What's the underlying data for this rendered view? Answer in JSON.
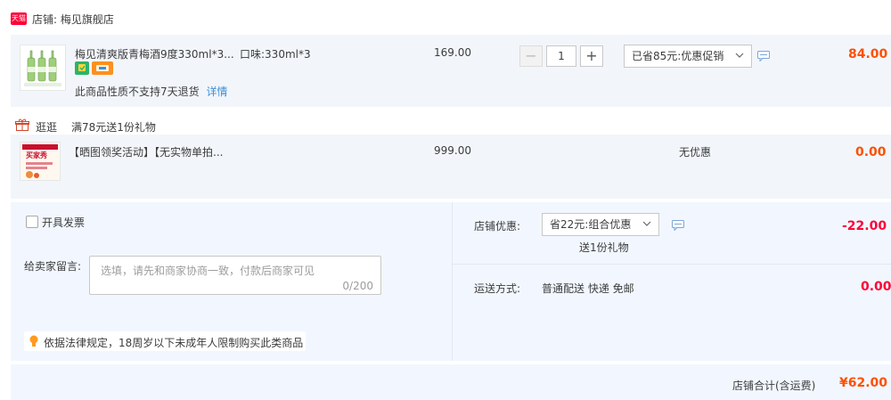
{
  "shop": {
    "badge": "天猫",
    "label": "店铺:",
    "name": "梅见旗舰店"
  },
  "item1": {
    "title": "梅见清爽版青梅酒9度330ml*3...",
    "sku": "口味:330ml*3",
    "unit_price": "169.00",
    "quantity": "1",
    "promo": "已省85元:优惠促销",
    "note": "此商品性质不支持7天退货",
    "note_link": "详情",
    "total": "84.00"
  },
  "gift_section": {
    "label": "逛逛",
    "desc": "满78元送1份礼物"
  },
  "item2": {
    "title": "【晒图领奖活动】【无实物单拍...",
    "unit_price": "999.00",
    "promo": "无优惠",
    "total": "0.00",
    "thumb_text": "买家秀"
  },
  "invoice": {
    "label": "开具发票"
  },
  "message": {
    "label": "给卖家留言:",
    "placeholder": "选填，请先和商家协商一致，付款后商家可见",
    "counter": "0/200"
  },
  "notice": {
    "text": "依据法律规定，18周岁以下未成年人限制购买此类商品"
  },
  "shop_discount": {
    "label": "店铺优惠:",
    "select": "省22元:组合优惠",
    "sub": "送1份礼物",
    "amount": "-22.00"
  },
  "shipping": {
    "label": "运送方式:",
    "method": "普通配送 快递 免邮",
    "amount": "0.00"
  },
  "footer": {
    "label": "店铺合计(含运费)",
    "total": "¥62.00"
  },
  "colors": {
    "accent": "#ff5000",
    "red": "#ff0036",
    "row_bg": "#f2f6fb",
    "section_bg": "#f2f7ff",
    "link": "#3c8fd6"
  }
}
